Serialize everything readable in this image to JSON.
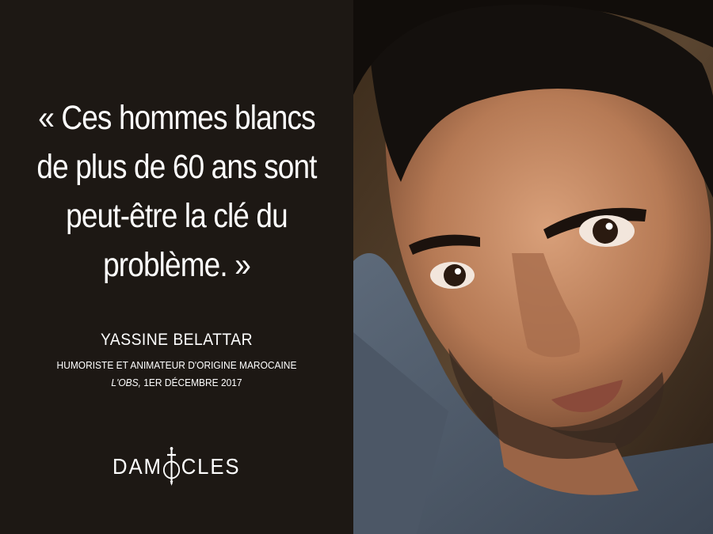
{
  "quote": {
    "lines": [
      "« Ces hommes blancs",
      "de plus de 60 ans sont",
      "peut-être la clé du",
      "problème. »"
    ]
  },
  "author": {
    "name": "YASSINE BELATTAR",
    "role": "HUMORISTE ET ANIMATEUR D'ORIGINE MAROCAINE",
    "publication": "L'OBS,",
    "date": "1ER DÉCEMBRE 2017"
  },
  "logo": {
    "part1": "DAM",
    "part2": "CLES"
  },
  "colors": {
    "panel": "#1d1814",
    "text": "#ffffff",
    "sword": "#ffffff"
  }
}
